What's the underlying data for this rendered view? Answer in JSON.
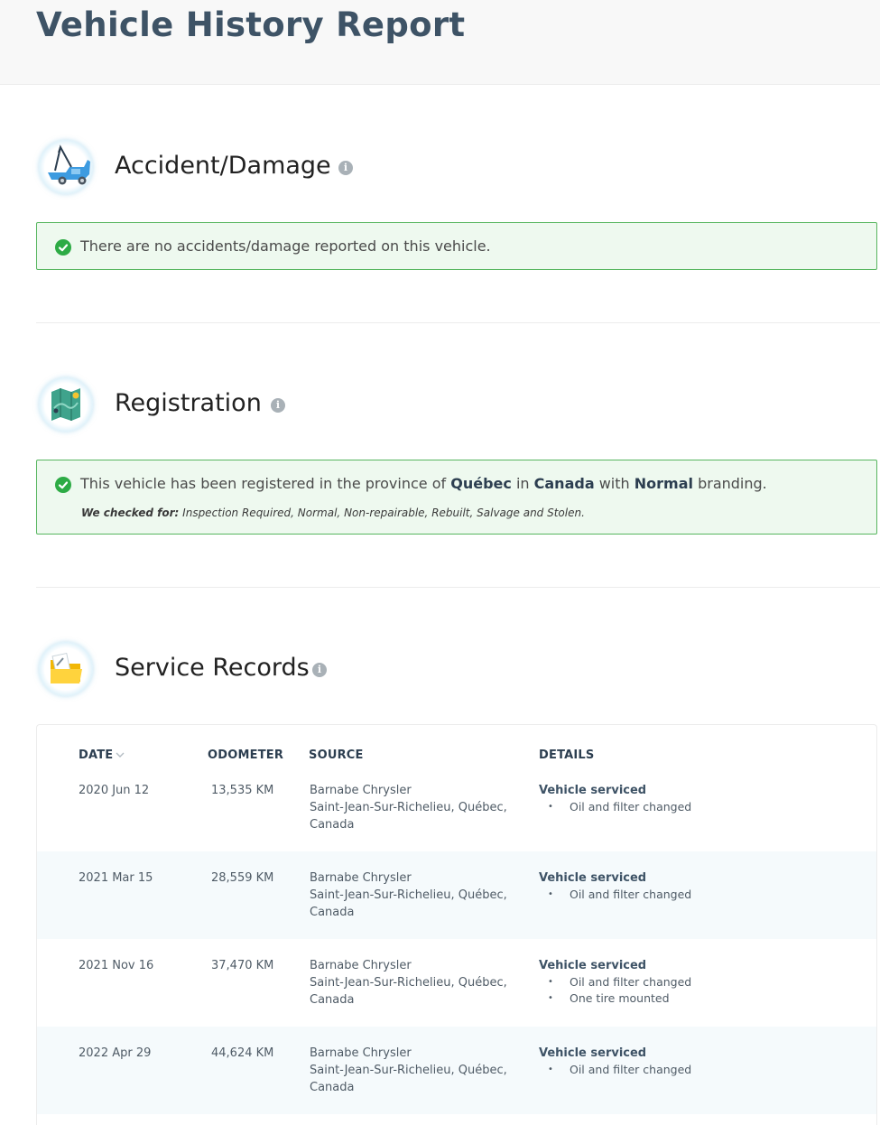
{
  "page": {
    "title": "Vehicle History Report"
  },
  "accident": {
    "title": "Accident/Damage",
    "message": "There are no accidents/damage reported on this vehicle.",
    "icon": "tow-truck-icon"
  },
  "registration": {
    "title": "Registration",
    "msg_prefix": "This vehicle has been registered in the province of",
    "province": "Québec",
    "msg_in": "in",
    "country": "Canada",
    "msg_with": "with",
    "branding": "Normal",
    "msg_suffix": "branding.",
    "checked_label": "We checked for:",
    "checked_list": "Inspection Required, Normal, Non-repairable, Rebuilt, Salvage and Stolen.",
    "icon": "map-icon"
  },
  "service": {
    "title": "Service Records",
    "icon": "folder-icon",
    "columns": {
      "date": "DATE",
      "odometer": "ODOMETER",
      "source": "SOURCE",
      "details": "DETAILS"
    },
    "rows": [
      {
        "date": "2020 Jun 12",
        "odometer": "13,535 KM",
        "source_line1": "Barnabe Chrysler",
        "source_line2": "Saint-Jean-Sur-Richelieu, Québec,",
        "source_line3": "Canada",
        "detail_title": "Vehicle serviced",
        "items": [
          "Oil and filter changed"
        ]
      },
      {
        "date": "2021 Mar 15",
        "odometer": "28,559 KM",
        "source_line1": "Barnabe Chrysler",
        "source_line2": "Saint-Jean-Sur-Richelieu, Québec,",
        "source_line3": "Canada",
        "detail_title": "Vehicle serviced",
        "items": [
          "Oil and filter changed"
        ]
      },
      {
        "date": "2021 Nov 16",
        "odometer": "37,470 KM",
        "source_line1": "Barnabe Chrysler",
        "source_line2": "Saint-Jean-Sur-Richelieu, Québec,",
        "source_line3": "Canada",
        "detail_title": "Vehicle serviced",
        "items": [
          "Oil and filter changed",
          "One tire mounted"
        ]
      },
      {
        "date": "2022 Apr 29",
        "odometer": "44,624 KM",
        "source_line1": "Barnabe Chrysler",
        "source_line2": "Saint-Jean-Sur-Richelieu, Québec,",
        "source_line3": "Canada",
        "detail_title": "Vehicle serviced",
        "items": [
          "Oil and filter changed"
        ]
      }
    ]
  },
  "colors": {
    "success_border": "#57b65f",
    "success_bg": "#eef9ef",
    "check_green": "#2dab45",
    "title_color": "#3e5366"
  }
}
